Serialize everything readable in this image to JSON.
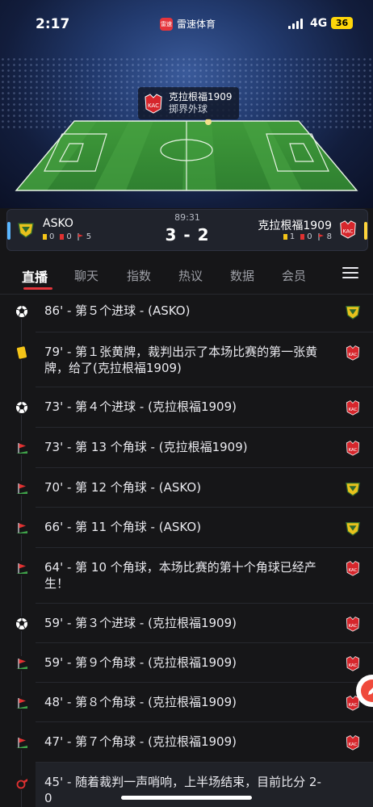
{
  "status_bar": {
    "time": "2:17",
    "network": "4G",
    "battery": "36",
    "app_brand": "雷速体育",
    "brand_logo_text": "雷速"
  },
  "pitch": {
    "event_team": "克拉根福1909",
    "event_type": "掷界外球",
    "ad_text": "雷速体育"
  },
  "match": {
    "minute": "89:31",
    "score": "3 - 2",
    "home": {
      "name": "ASKO",
      "yellow": "0",
      "red": "0",
      "corners": "5",
      "color": "#5ab7ff"
    },
    "away": {
      "name": "克拉根福1909",
      "yellow": "1",
      "red": "0",
      "corners": "8",
      "color": "#ffd43b"
    }
  },
  "tabs": [
    {
      "label": "直播",
      "active": true
    },
    {
      "label": "聊天"
    },
    {
      "label": "指数"
    },
    {
      "label": "热议"
    },
    {
      "label": "数据"
    },
    {
      "label": "会员"
    }
  ],
  "events": [
    {
      "icon": "ball",
      "text": "86' - 第５个进球 - (ASKO)",
      "team": "home"
    },
    {
      "icon": "yellow-card",
      "text": "79' - 第１张黄牌，裁判出示了本场比赛的第一张黄牌，给了(克拉根福1909)",
      "team": "away"
    },
    {
      "icon": "ball",
      "text": "73' - 第４个进球 - (克拉根福1909)",
      "team": "away"
    },
    {
      "icon": "corner",
      "text": "73' - 第 13 个角球 - (克拉根福1909)",
      "team": "away"
    },
    {
      "icon": "corner",
      "text": "70' - 第 12 个角球 - (ASKO)",
      "team": "home"
    },
    {
      "icon": "corner",
      "text": "66' - 第 11 个角球 - (ASKO)",
      "team": "home"
    },
    {
      "icon": "corner",
      "text": "64' - 第 10 个角球，本场比赛的第十个角球已经产生！",
      "team": "away"
    },
    {
      "icon": "ball",
      "text": "59' - 第３个进球 - (克拉根福1909)",
      "team": "away"
    },
    {
      "icon": "corner",
      "text": "59' - 第９个角球 - (克拉根福1909)",
      "team": "away"
    },
    {
      "icon": "corner",
      "text": "48' - 第８个角球 - (克拉根福1909)",
      "team": "away"
    },
    {
      "icon": "corner",
      "text": "47' - 第７个角球 - (克拉根福1909)",
      "team": "away"
    },
    {
      "icon": "whistle",
      "text": "45' - 随着裁判一声哨响，上半场结束，目前比分 2-0",
      "team": ""
    }
  ]
}
